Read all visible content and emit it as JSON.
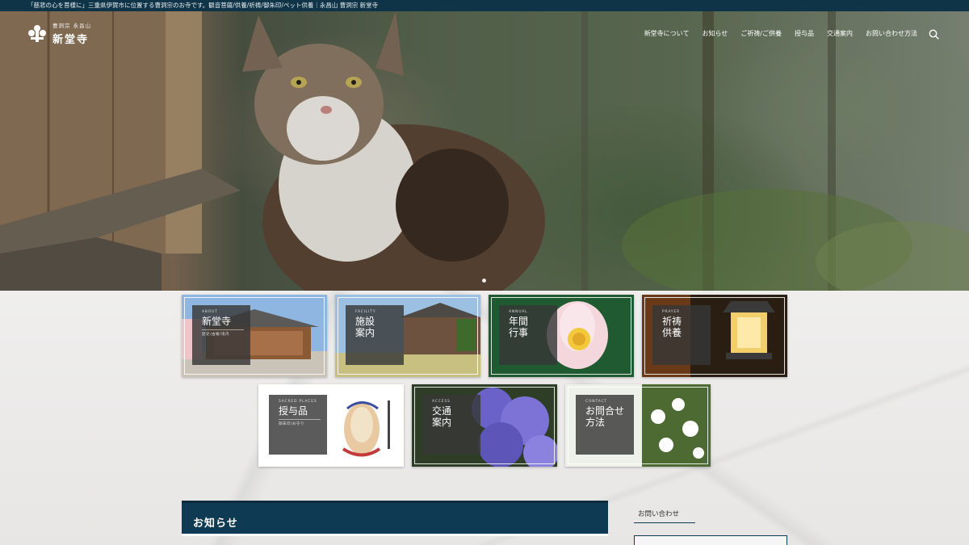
{
  "topbar": {
    "text": "「慈悲の心を菩様に」三重県伊賀市に位置する曹洞宗のお寺です。観音菩薩/供養/祈祷/御朱印/ペット供養｜永昌山 曹洞宗 新堂寺"
  },
  "logo": {
    "sub": "曹洞宗 永昌山",
    "main": "新堂寺"
  },
  "nav": {
    "items": [
      "新堂寺について",
      "お知らせ",
      "ご祈祷/ご供養",
      "授与品",
      "交通案内",
      "お問い合わせ方法"
    ]
  },
  "cards": [
    {
      "en": "ABOUT",
      "jp": "新堂寺",
      "sub": "歴史/由緒/境内"
    },
    {
      "en": "FACILITY",
      "jp": "施設\n案内",
      "sub": ""
    },
    {
      "en": "ANNUAL",
      "jp": "年間\n行事",
      "sub": ""
    },
    {
      "en": "PRAYER",
      "jp": "祈祷\n供養",
      "sub": ""
    },
    {
      "en": "SACRED PLACES",
      "jp": "授与品",
      "sub": "御朱印/お守り"
    },
    {
      "en": "ACCESS",
      "jp": "交通\n案内",
      "sub": ""
    },
    {
      "en": "CONTACT",
      "jp": "お問合せ\n方法",
      "sub": ""
    }
  ],
  "news": {
    "title": "お知らせ"
  },
  "sidebar": {
    "title": "お問い合わせ"
  },
  "colors": {
    "navy": "#0e3a54",
    "topbar": "#0f3448"
  }
}
